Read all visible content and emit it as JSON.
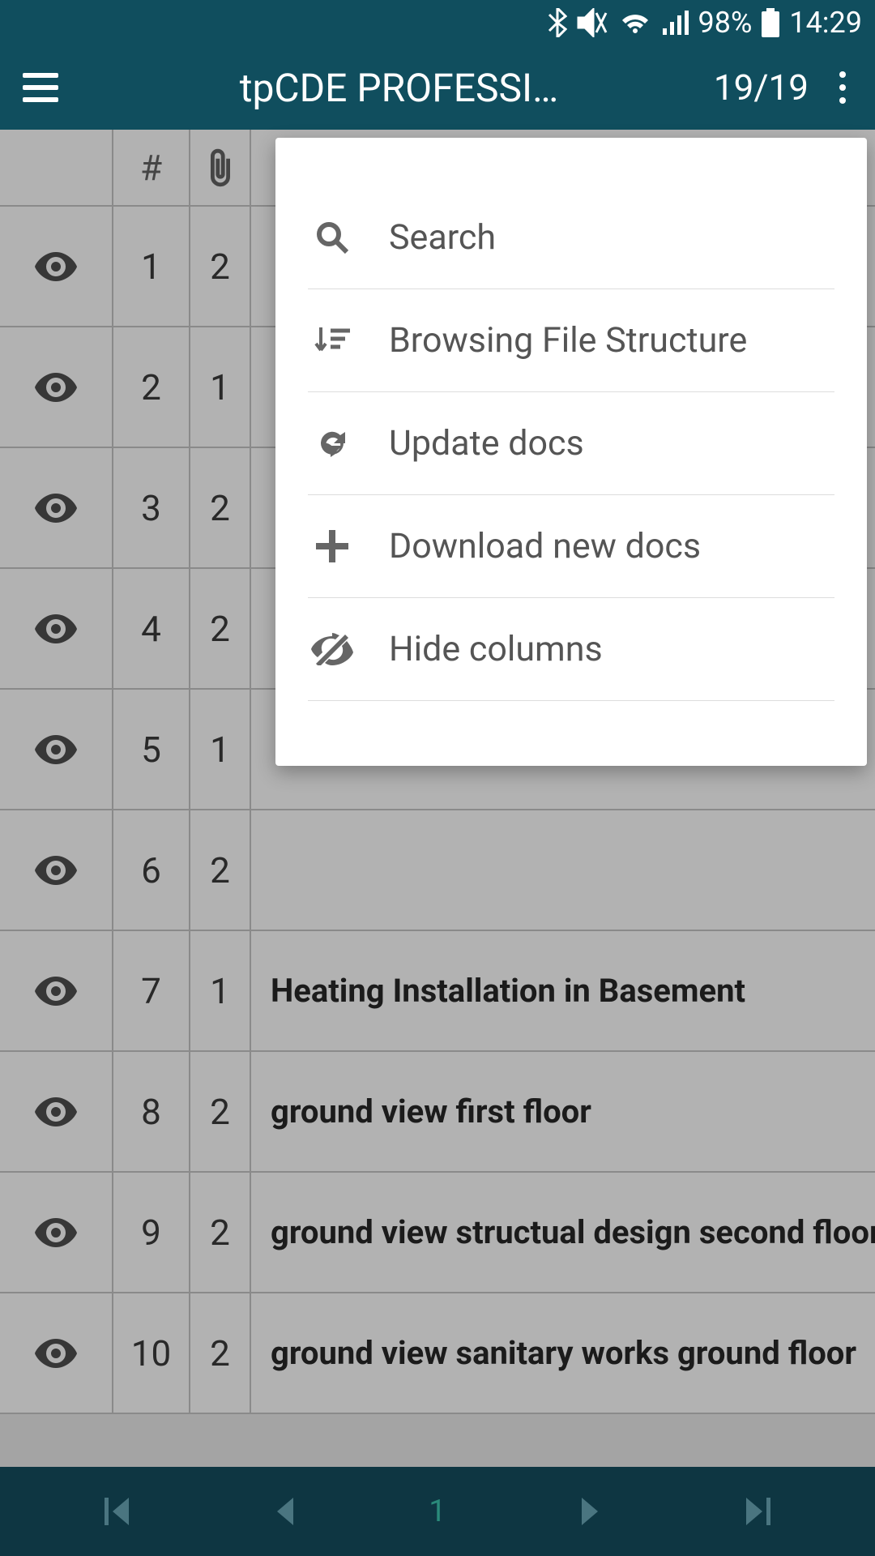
{
  "status_bar": {
    "battery_pct": "98%",
    "time": "14:29"
  },
  "app_bar": {
    "title": "tpCDE PROFESSI…",
    "counter": "19/19"
  },
  "table": {
    "header_hash": "#",
    "rows": [
      {
        "num": "1",
        "attach": "2",
        "name": ""
      },
      {
        "num": "2",
        "attach": "1",
        "name": ""
      },
      {
        "num": "3",
        "attach": "2",
        "name": ""
      },
      {
        "num": "4",
        "attach": "2",
        "name": ""
      },
      {
        "num": "5",
        "attach": "1",
        "name": ""
      },
      {
        "num": "6",
        "attach": "2",
        "name": ""
      },
      {
        "num": "7",
        "attach": "1",
        "name": "Heating Installation in Basement"
      },
      {
        "num": "8",
        "attach": "2",
        "name": "ground view first floor"
      },
      {
        "num": "9",
        "attach": "2",
        "name": "ground view structual design second floor"
      },
      {
        "num": "10",
        "attach": "2",
        "name": "ground view sanitary works ground floor"
      }
    ]
  },
  "popup": {
    "items": [
      {
        "icon": "search",
        "label": "Search"
      },
      {
        "icon": "sort",
        "label": "Browsing File Structure"
      },
      {
        "icon": "refresh",
        "label": "Update docs"
      },
      {
        "icon": "plus",
        "label": "Download new docs"
      },
      {
        "icon": "hide",
        "label": "Hide columns"
      }
    ]
  },
  "bottom_nav": {
    "page": "1"
  }
}
